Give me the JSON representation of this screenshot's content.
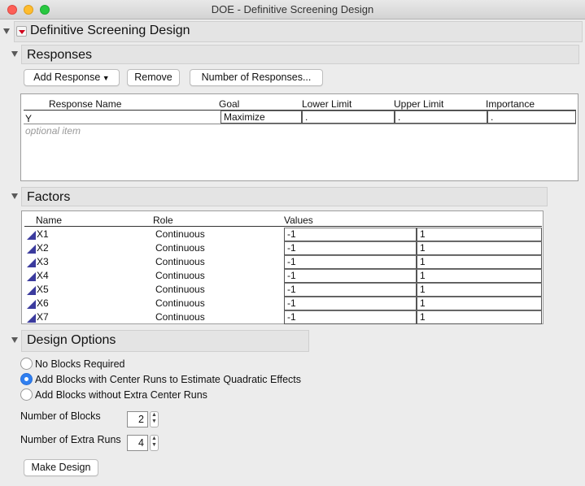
{
  "window": {
    "title": "DOE - Definitive Screening Design"
  },
  "main": {
    "title": "Definitive Screening Design"
  },
  "responses": {
    "title": "Responses",
    "buttons": {
      "add": "Add Response",
      "remove": "Remove",
      "number": "Number of Responses..."
    },
    "headers": {
      "name": "Response Name",
      "goal": "Goal",
      "lower": "Lower Limit",
      "upper": "Upper Limit",
      "importance": "Importance"
    },
    "rows": [
      {
        "name": "Y",
        "goal": "Maximize",
        "lower": ".",
        "upper": ".",
        "importance": "."
      }
    ],
    "optional": "optional item"
  },
  "factors": {
    "title": "Factors",
    "headers": {
      "name": "Name",
      "role": "Role",
      "values": "Values"
    },
    "rows": [
      {
        "name": "X1",
        "role": "Continuous",
        "low": "-1",
        "high": "1"
      },
      {
        "name": "X2",
        "role": "Continuous",
        "low": "-1",
        "high": "1"
      },
      {
        "name": "X3",
        "role": "Continuous",
        "low": "-1",
        "high": "1"
      },
      {
        "name": "X4",
        "role": "Continuous",
        "low": "-1",
        "high": "1"
      },
      {
        "name": "X5",
        "role": "Continuous",
        "low": "-1",
        "high": "1"
      },
      {
        "name": "X6",
        "role": "Continuous",
        "low": "-1",
        "high": "1"
      },
      {
        "name": "X7",
        "role": "Continuous",
        "low": "-1",
        "high": "1"
      }
    ]
  },
  "design_options": {
    "title": "Design Options",
    "radios": [
      {
        "label": "No Blocks Required",
        "selected": false
      },
      {
        "label": "Add Blocks with Center Runs to Estimate Quadratic Effects",
        "selected": true
      },
      {
        "label": "Add Blocks without Extra Center Runs",
        "selected": false
      }
    ],
    "blocks_label": "Number of Blocks",
    "blocks_value": "2",
    "extra_runs_label": "Number of Extra Runs",
    "extra_runs_value": "4",
    "make_design": "Make Design"
  },
  "colors": {
    "accent": "#2f7ff0",
    "red_triangle": "#d0021b",
    "factor_icon": "#3b3b9e"
  }
}
